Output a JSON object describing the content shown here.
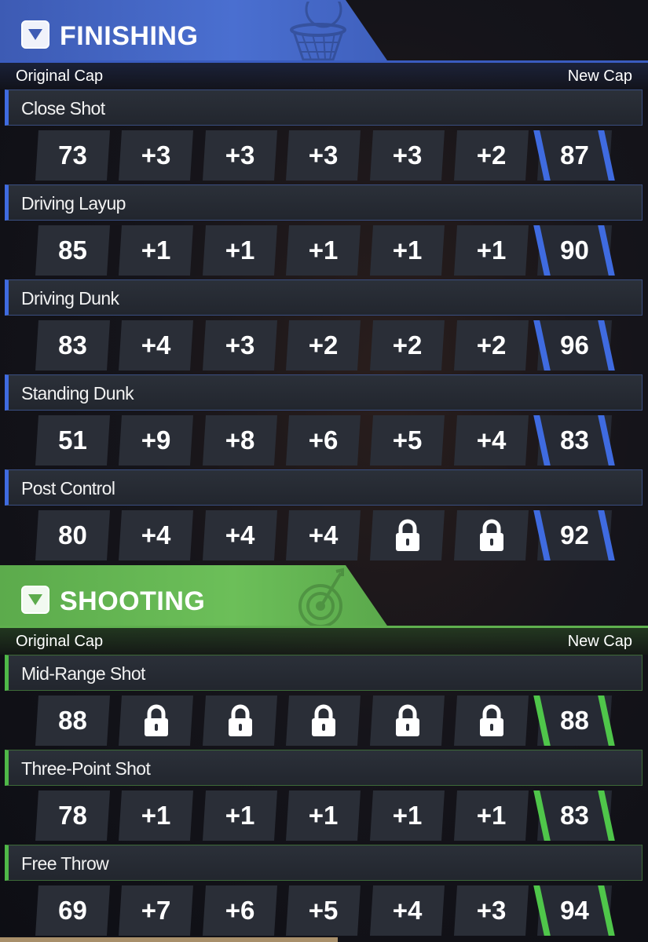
{
  "sections": [
    {
      "id": "finishing",
      "title": "FINISHING",
      "original_cap_label": "Original Cap",
      "new_cap_label": "New Cap",
      "accent_color": "#3f6be0",
      "attributes": [
        {
          "name": "Close Shot",
          "original": "73",
          "boosts": [
            "+3",
            "+3",
            "+3",
            "+3",
            "+2"
          ],
          "new_cap": "87"
        },
        {
          "name": "Driving Layup",
          "original": "85",
          "boosts": [
            "+1",
            "+1",
            "+1",
            "+1",
            "+1"
          ],
          "new_cap": "90"
        },
        {
          "name": "Driving Dunk",
          "original": "83",
          "boosts": [
            "+4",
            "+3",
            "+2",
            "+2",
            "+2"
          ],
          "new_cap": "96"
        },
        {
          "name": "Standing Dunk",
          "original": "51",
          "boosts": [
            "+9",
            "+8",
            "+6",
            "+5",
            "+4"
          ],
          "new_cap": "83"
        },
        {
          "name": "Post Control",
          "original": "80",
          "boosts": [
            "+4",
            "+4",
            "+4",
            "lock",
            "lock"
          ],
          "new_cap": "92"
        }
      ]
    },
    {
      "id": "shooting",
      "title": "SHOOTING",
      "original_cap_label": "Original Cap",
      "new_cap_label": "New Cap",
      "accent_color": "#4fc64a",
      "attributes": [
        {
          "name": "Mid-Range Shot",
          "original": "88",
          "boosts": [
            "lock",
            "lock",
            "lock",
            "lock",
            "lock"
          ],
          "new_cap": "88"
        },
        {
          "name": "Three-Point Shot",
          "original": "78",
          "boosts": [
            "+1",
            "+1",
            "+1",
            "+1",
            "+1"
          ],
          "new_cap": "83"
        },
        {
          "name": "Free Throw",
          "original": "69",
          "boosts": [
            "+7",
            "+6",
            "+5",
            "+4",
            "+3"
          ],
          "new_cap": "94"
        }
      ]
    }
  ],
  "icons": {
    "toggle": "chevron-down-icon",
    "lock": "lock-icon",
    "finishing_art": "basketball-hoop-icon",
    "shooting_art": "target-rocket-icon"
  }
}
